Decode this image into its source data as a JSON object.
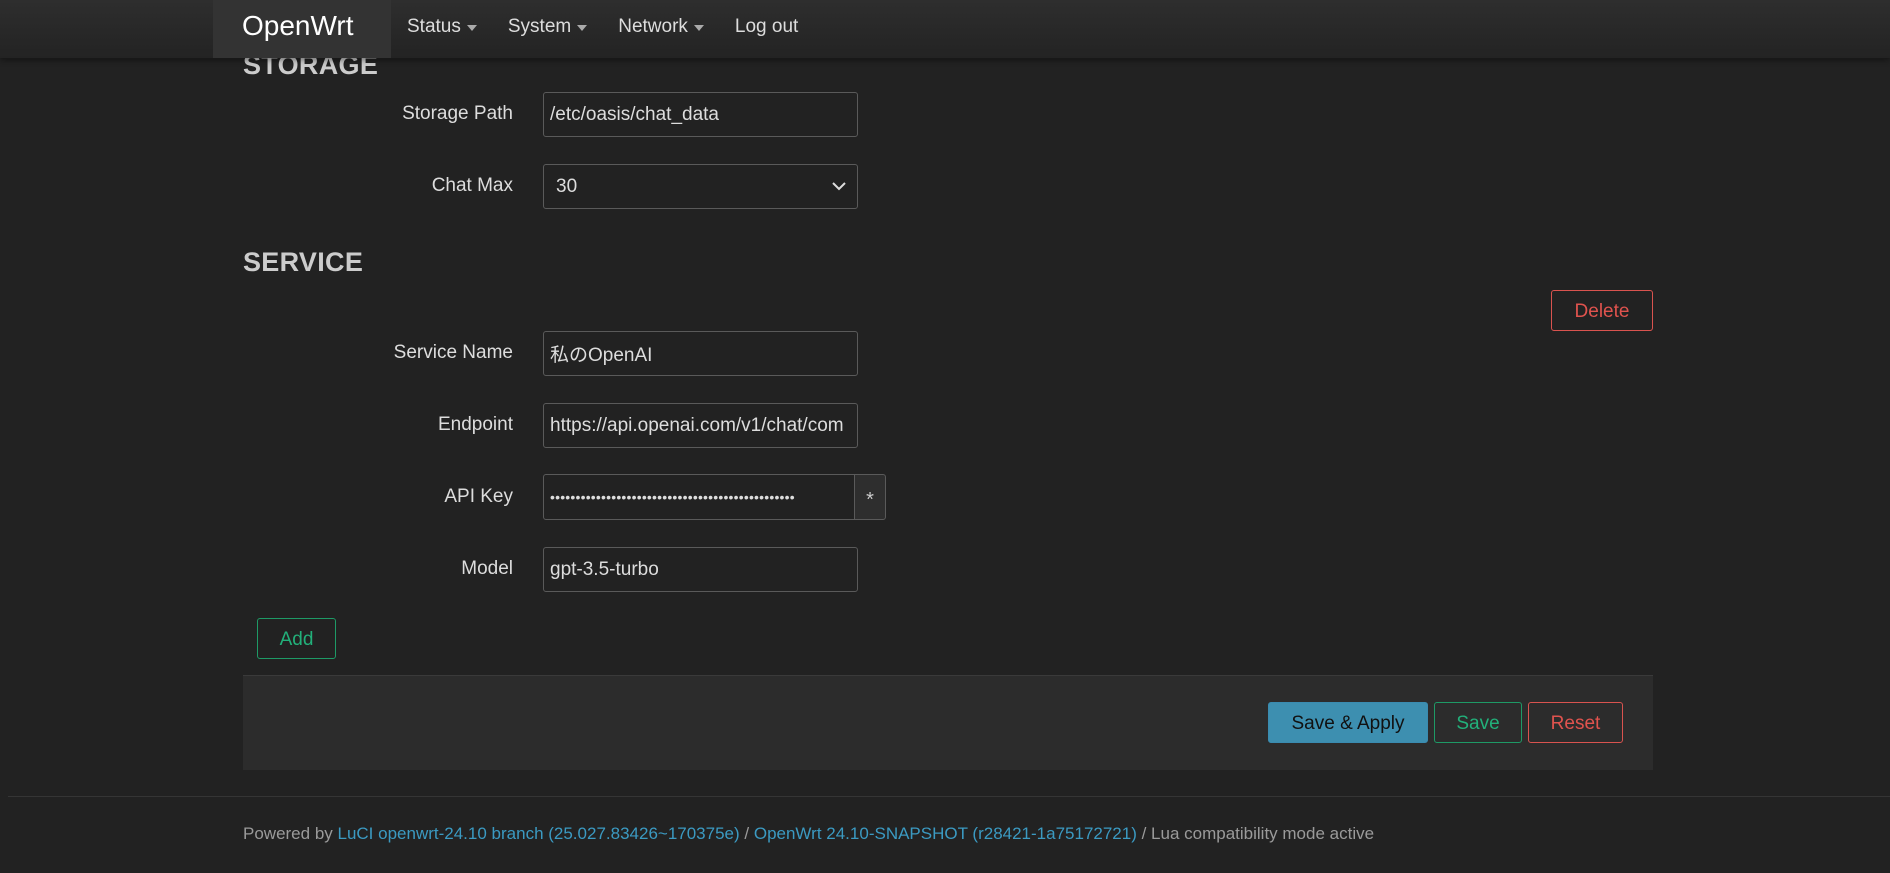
{
  "navbar": {
    "brand": "OpenWrt",
    "menu": [
      {
        "label": "Status",
        "dropdown": true
      },
      {
        "label": "System",
        "dropdown": true
      },
      {
        "label": "Network",
        "dropdown": true
      },
      {
        "label": "Log out",
        "dropdown": false
      }
    ]
  },
  "storage": {
    "title": "STORAGE",
    "path_label": "Storage Path",
    "path_value": "/etc/oasis/chat_data",
    "chat_max_label": "Chat Max",
    "chat_max_value": "30"
  },
  "service": {
    "title": "SERVICE",
    "delete_label": "Delete",
    "name_label": "Service Name",
    "name_value": "私のOpenAI",
    "endpoint_label": "Endpoint",
    "endpoint_value": "https://api.openai.com/v1/chat/com",
    "api_key_label": "API Key",
    "api_key_masked": "••••••••••••••••••••••••••••••••••••••••••••••••",
    "reveal_label": "*",
    "model_label": "Model",
    "model_value": "gpt-3.5-turbo",
    "add_label": "Add"
  },
  "actions": {
    "save_apply": "Save & Apply",
    "save": "Save",
    "reset": "Reset"
  },
  "footer": {
    "prefix": "Powered by ",
    "luci_link": "LuCI openwrt-24.10 branch (25.027.83426~170375e)",
    "sep1": " / ",
    "openwrt_link": "OpenWrt 24.10-SNAPSHOT (r28421-1a75172721)",
    "suffix": " / Lua compatibility mode active"
  },
  "colors": {
    "background": "#222222",
    "accent_blue": "#3d8fb0",
    "positive_green": "#22b07a",
    "negative_red": "#e0534e",
    "link": "#3b9ac2"
  }
}
